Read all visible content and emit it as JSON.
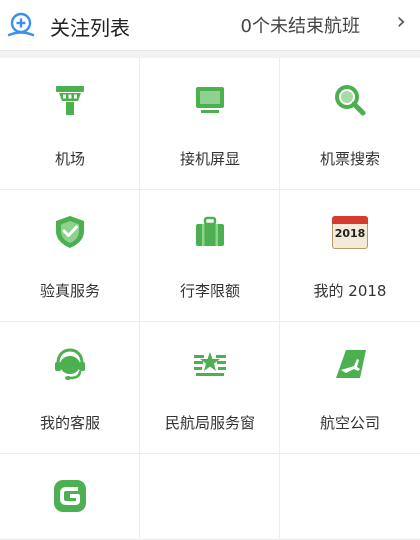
{
  "header": {
    "title": "关注列表",
    "status": "0个未结束航班",
    "chevron": "›",
    "icon": "add-flight-icon"
  },
  "colors": {
    "accent_green": "#4caf50",
    "header_icon_blue": "#3b8ff0"
  },
  "grid": {
    "items": [
      {
        "label": "机场",
        "icon": "airport-tower-icon"
      },
      {
        "label": "接机屏显",
        "icon": "monitor-icon"
      },
      {
        "label": "机票搜索",
        "icon": "search-icon"
      },
      {
        "label": "验真服务",
        "icon": "shield-check-icon"
      },
      {
        "label": "行李限额",
        "icon": "luggage-icon"
      },
      {
        "label": "我的 2018",
        "icon": "calendar-icon",
        "badge": "2018"
      },
      {
        "label": "我的客服",
        "icon": "headset-icon"
      },
      {
        "label": "民航局服务窗",
        "icon": "star-emblem-icon"
      },
      {
        "label": "航空公司",
        "icon": "airline-tail-icon"
      },
      {
        "label": "",
        "icon": "g-logo-icon"
      }
    ]
  }
}
